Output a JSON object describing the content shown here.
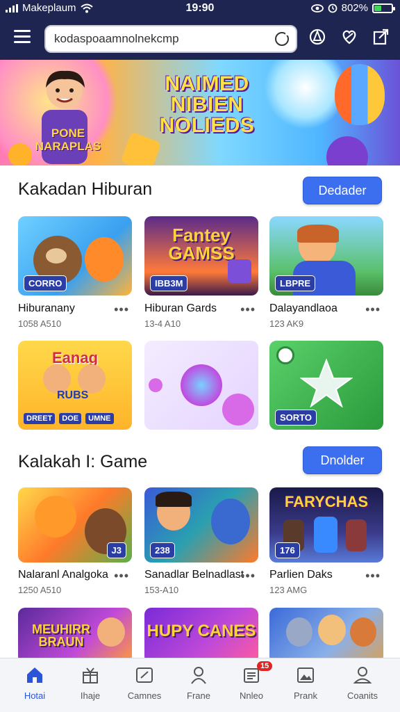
{
  "status": {
    "carrier": "Makeplaum",
    "time": "19:90",
    "battery": "802%"
  },
  "browser": {
    "url": "kodaspoaamnolnekcmp"
  },
  "banner": {
    "title": "NAIMED NIBIEN NOLIEDS",
    "shirt_text": "PONE NARAPLAS"
  },
  "sections": [
    {
      "title": "Kakadan Hiburan",
      "button": "Dedader",
      "cards": [
        {
          "badge": "CORRO",
          "name": "Hiburanany",
          "meta": "1058 A510",
          "art_title": ""
        },
        {
          "badge": "IBB3M",
          "name": "Hiburan Gards",
          "meta": "13-4 A10",
          "art_title": "Fantey GAMSS"
        },
        {
          "badge": "LBPRE",
          "name": "Dalayandlaoa",
          "meta": "123 AK9",
          "art_title": ""
        },
        {
          "badge": "",
          "name": "",
          "meta": "",
          "art_title": "Eanag",
          "sub_labels": [
            "DREET",
            "DOE",
            "UMNE"
          ],
          "plate": "RUBS"
        },
        {
          "badge": "",
          "name": "",
          "meta": "",
          "art_title": ""
        },
        {
          "badge": "SORTO",
          "name": "",
          "meta": "",
          "art_title": ""
        }
      ]
    },
    {
      "title": "Kalakah I: Game",
      "button": "Dnolder",
      "cards": [
        {
          "badge": "J3",
          "name": "Nalaranl Analgoka",
          "meta": "1250 A510",
          "art_title": ""
        },
        {
          "badge": "238",
          "name": "Sanadlar Belnadlast",
          "meta": "153-A10",
          "art_title": ""
        },
        {
          "badge": "176",
          "name": "Parlien Daks",
          "meta": "123 AMG",
          "art_title": "FARYCHAS"
        },
        {
          "badge": "",
          "name": "",
          "meta": "",
          "art_title": "MEUHIRR BRAUN"
        },
        {
          "badge": "",
          "name": "",
          "meta": "",
          "art_title": "HUPY CANES"
        },
        {
          "badge": "",
          "name": "",
          "meta": "",
          "art_title": ""
        }
      ]
    }
  ],
  "bottom_nav": [
    {
      "label": "Hotai",
      "icon": "home-icon",
      "active": true
    },
    {
      "label": "Ihaje",
      "icon": "gift-icon",
      "active": false
    },
    {
      "label": "Camnes",
      "icon": "game-icon",
      "active": false
    },
    {
      "label": "Frane",
      "icon": "friends-icon",
      "active": false
    },
    {
      "label": "Nnleo",
      "icon": "news-icon",
      "active": false,
      "badge": "15"
    },
    {
      "label": "Prank",
      "icon": "image-icon",
      "active": false
    },
    {
      "label": "Coanits",
      "icon": "profile-icon",
      "active": false
    }
  ],
  "colors": {
    "topbar": "#1e2550",
    "accent": "#3c6ef0",
    "badge": "#2a3ea6",
    "active_nav": "#2b55d8"
  }
}
